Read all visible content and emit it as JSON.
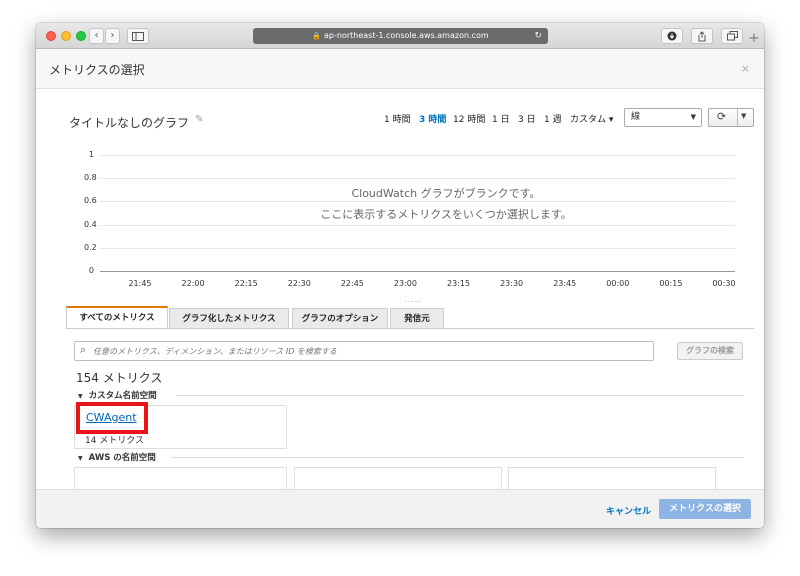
{
  "browser": {
    "url": "ap-northeast-1.console.aws.amazon.com",
    "back_label": "‹",
    "forward_label": "›"
  },
  "modal": {
    "title": "メトリクスの選択",
    "close": "×"
  },
  "graph": {
    "title": "タイトルなしのグラフ",
    "time_ranges": [
      "1 時間",
      "3 時間",
      "12 時間",
      "1 日",
      "3 日",
      "1 週",
      "カスタム ▾"
    ],
    "active_time_range": "3 時間",
    "chart_type": "線"
  },
  "chart_data": {
    "type": "line",
    "y_ticks": [
      "1",
      "0.8",
      "0.6",
      "0.4",
      "0.2",
      "0"
    ],
    "x_ticks": [
      "21:45",
      "22:00",
      "22:15",
      "22:30",
      "22:45",
      "23:00",
      "23:15",
      "23:30",
      "23:45",
      "00:00",
      "00:15",
      "00:30"
    ],
    "ylim": [
      0,
      1
    ],
    "series": [],
    "message_line1": "CloudWatch グラフがブランクです。",
    "message_line2": "ここに表示するメトリクスをいくつか選択します。"
  },
  "tabs": [
    {
      "label": "すべてのメトリクス",
      "active": true
    },
    {
      "label": "グラフ化したメトリクス",
      "active": false
    },
    {
      "label": "グラフのオプション",
      "active": false
    },
    {
      "label": "発信元",
      "active": false
    }
  ],
  "search": {
    "placeholder": "任意のメトリクス、ディメンション、またはリソース ID を検索する",
    "graph_search_label": "グラフの検索"
  },
  "metrics": {
    "count_label": "154 メトリクス",
    "custom_namespace_label": "カスタム名前空間",
    "custom_namespaces": [
      {
        "name": "CWAgent",
        "count_label": "14 メトリクス"
      }
    ],
    "aws_namespace_label": "AWS の名前空間"
  },
  "footer": {
    "cancel": "キャンセル",
    "select": "メトリクスの選択"
  },
  "colors": {
    "accent": "#0073bb",
    "highlight": "#e8141a",
    "active_tab": "#e07b00",
    "primary_button_disabled": "#8db4e2"
  }
}
